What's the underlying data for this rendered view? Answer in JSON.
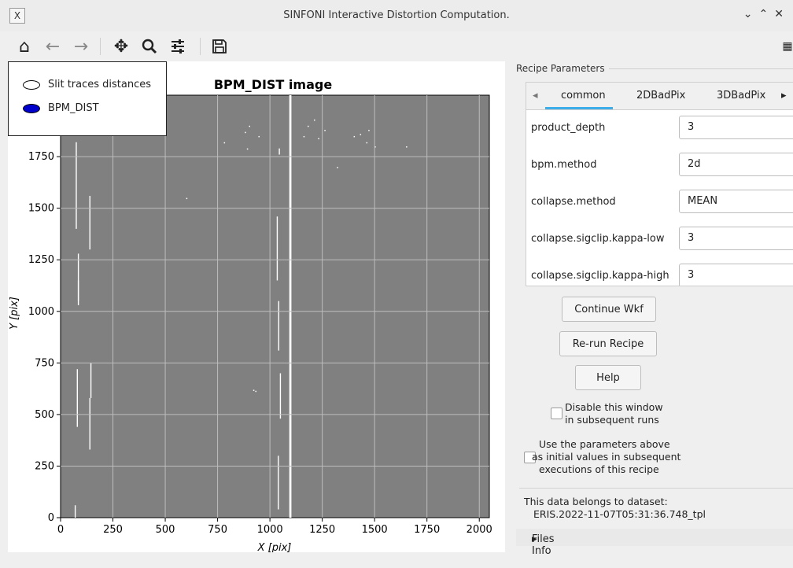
{
  "window": {
    "title": "SINFONI Interactive Distortion Computation.",
    "app_icon_glyph": "X",
    "controls": [
      "minimize",
      "maximize",
      "close"
    ]
  },
  "toolbar": {
    "buttons": [
      {
        "icon": "home-icon"
      },
      {
        "icon": "back-arrow-icon"
      },
      {
        "icon": "forward-arrow-icon"
      },
      {
        "icon": "pan-icon"
      },
      {
        "icon": "zoom-icon"
      },
      {
        "icon": "configure-subplots-icon"
      },
      {
        "icon": "save-icon"
      }
    ]
  },
  "plot": {
    "title": "BPM_DIST image",
    "xlabel": "X [pix]",
    "ylabel": "Y [pix]",
    "xticks": [
      "0",
      "250",
      "500",
      "750",
      "1000",
      "1250",
      "1500",
      "1750",
      "2000"
    ],
    "yticks": [
      "0",
      "250",
      "500",
      "750",
      "1000",
      "1250",
      "1500",
      "1750"
    ],
    "image_color": "#808080",
    "legend": [
      {
        "label": "Slit traces distances",
        "fill": "#ffffff"
      },
      {
        "label": "BPM_DIST",
        "fill": "#0000cc"
      }
    ]
  },
  "recipe": {
    "group_title": "Recipe Parameters",
    "tabs": [
      "common",
      "2DBadPix",
      "3DBadPix"
    ],
    "active_tab": "common",
    "params": [
      {
        "name": "product_depth",
        "value": "3"
      },
      {
        "name": "bpm.method",
        "value": "2d"
      },
      {
        "name": "collapse.method",
        "value": "MEAN"
      },
      {
        "name": "collapse.sigclip.kappa-low",
        "value": "3"
      },
      {
        "name": "collapse.sigclip.kappa-high",
        "value": "3"
      }
    ]
  },
  "actions": {
    "continue": "Continue Wkf",
    "rerun": "Re-run Recipe",
    "help": "Help"
  },
  "options": {
    "disable_line1": "Disable this window",
    "disable_line2": "in subsequent runs",
    "use_line1": "Use the parameters above",
    "use_line2": "as initial values in subsequent",
    "use_line3": "executions of this recipe"
  },
  "dataset": {
    "line1": "This data belongs to dataset:",
    "line2": "ERIS.2022-11-07T05:31:36.748_tpl"
  },
  "files_info": "Files Info"
}
